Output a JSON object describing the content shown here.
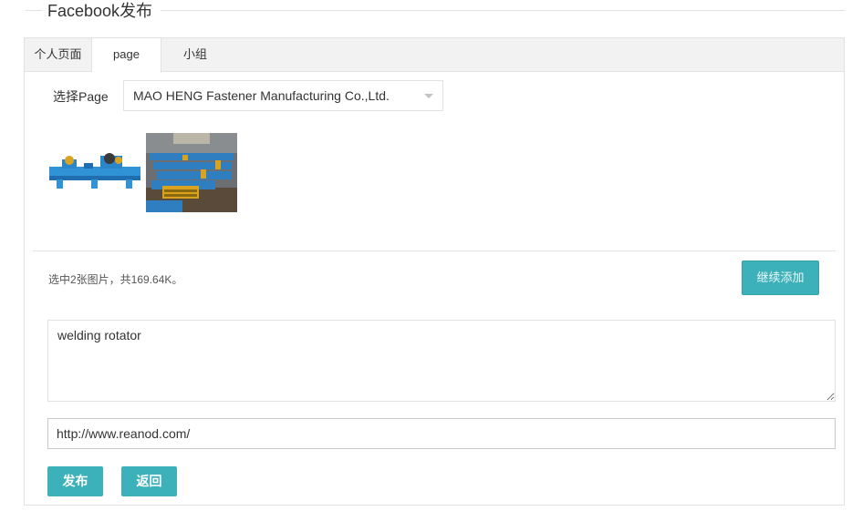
{
  "header": {
    "title": "Facebook发布"
  },
  "tabs": [
    {
      "label": "个人页面"
    },
    {
      "label": "page"
    },
    {
      "label": "小组"
    }
  ],
  "page_select": {
    "label": "选择Page",
    "selected": "MAO HENG Fastener Manufacturing Co.,Ltd."
  },
  "images": {
    "summary": "选中2张图片，共169.64K。",
    "add_more_label": "继续添加"
  },
  "post": {
    "message": "welding rotator",
    "link": "http://www.reanod.com/"
  },
  "actions": {
    "publish_label": "发布",
    "back_label": "返回"
  },
  "colors": {
    "accent": "#3db1b9",
    "border": "#e2e2e2",
    "tabbar_bg": "#f2f2f2"
  }
}
